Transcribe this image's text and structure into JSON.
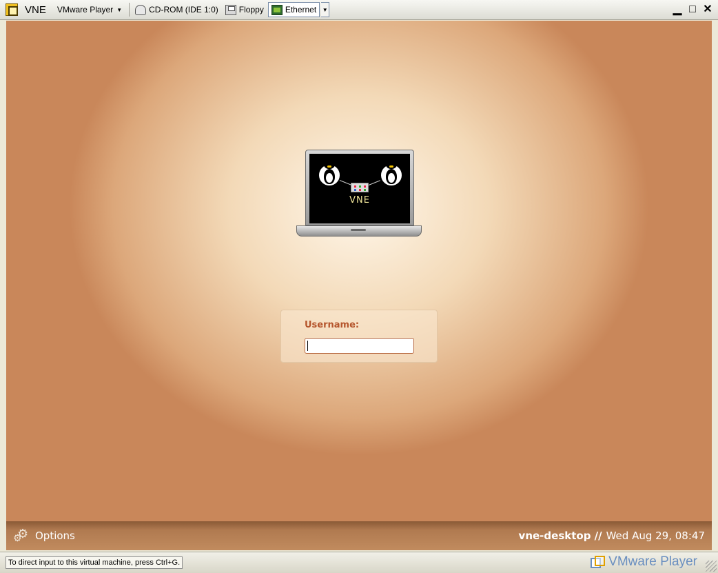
{
  "window": {
    "title": "VNE",
    "menu_label": "VMware Player",
    "devices": [
      {
        "label": "CD-ROM (IDE 1:0)",
        "icon": "cd-rom-icon"
      },
      {
        "label": "Floppy",
        "icon": "floppy-icon"
      },
      {
        "label": "Ethernet",
        "icon": "ethernet-icon",
        "active": true
      }
    ],
    "controls": {
      "minimize": "▁",
      "maximize": "□",
      "close": "✕"
    }
  },
  "vm": {
    "logo_text": "VNE",
    "login": {
      "label": "Username:",
      "value": ""
    },
    "panel": {
      "options_label": "Options",
      "hostname": "vne-desktop //",
      "datetime": "Wed Aug 29, 08:47"
    }
  },
  "statusbar": {
    "hint": "To direct input to this virtual machine, press Ctrl+G.",
    "brand": "VMware Player"
  },
  "colors": {
    "accent": "#b5552c",
    "panel_bg": "#b07a50",
    "brand": "#6a8fc0"
  }
}
